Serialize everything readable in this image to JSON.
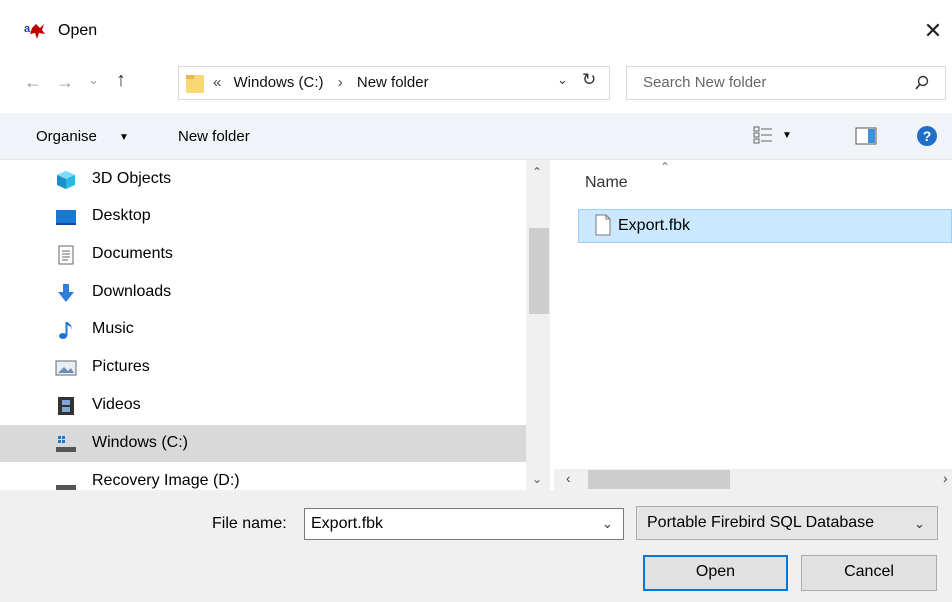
{
  "window": {
    "title": "Open",
    "close_glyph": "✕"
  },
  "address": {
    "breadcrumb_prefix": "«",
    "crumbs": [
      "Windows (C:)",
      "New folder"
    ],
    "separator": "›",
    "search_placeholder": "Search New folder"
  },
  "nav_buttons": {
    "back": "←",
    "forward": "→",
    "recent": "⌄",
    "up": "↑"
  },
  "toolbar": {
    "organise": "Organise",
    "new_folder": "New folder",
    "help": "?"
  },
  "nav_items": [
    {
      "label": "3D Objects",
      "icon": "3d-objects-icon"
    },
    {
      "label": "Desktop",
      "icon": "desktop-icon"
    },
    {
      "label": "Documents",
      "icon": "documents-icon"
    },
    {
      "label": "Downloads",
      "icon": "downloads-icon"
    },
    {
      "label": "Music",
      "icon": "music-icon"
    },
    {
      "label": "Pictures",
      "icon": "pictures-icon"
    },
    {
      "label": "Videos",
      "icon": "videos-icon"
    },
    {
      "label": "Windows (C:)",
      "icon": "drive-icon",
      "selected": true
    },
    {
      "label": "Recovery Image (D:)",
      "icon": "drive-icon"
    }
  ],
  "file_list": {
    "column_header": "Name",
    "files": [
      {
        "name": "Export.fbk",
        "selected": true
      }
    ]
  },
  "bottom": {
    "file_name_label": "File name:",
    "file_name_value": "Export.fbk",
    "file_type": "Portable Firebird SQL Database",
    "open_label": "Open",
    "cancel_label": "Cancel"
  },
  "colors": {
    "accent": "#0078d7",
    "selection": "#cce8ff",
    "nav_selected": "#d9d9d9",
    "help": "#1e6fc9"
  }
}
